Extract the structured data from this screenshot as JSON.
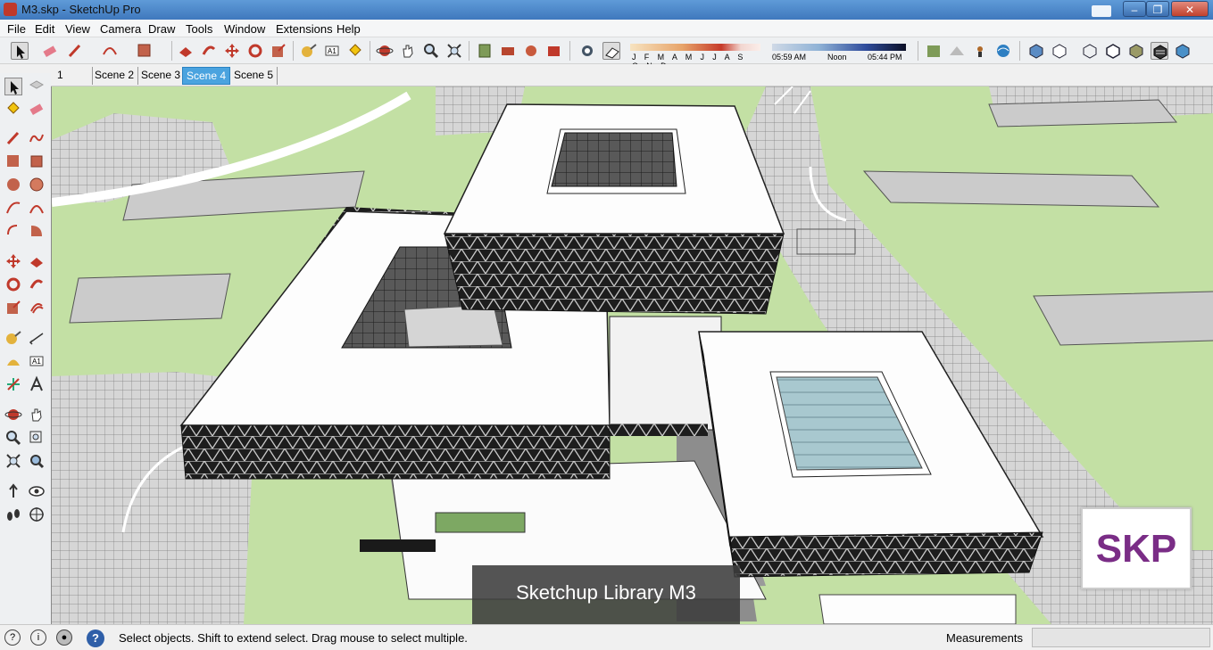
{
  "window": {
    "title": "M3.skp - SketchUp Pro"
  },
  "menu": [
    "File",
    "Edit",
    "View",
    "Camera",
    "Draw",
    "Tools",
    "Window",
    "Extensions",
    "Help"
  ],
  "shadows": {
    "months": "J F M A M J J A S O N D",
    "time_start": "05:59 AM",
    "time_mid": "Noon",
    "time_end": "05:44 PM"
  },
  "scenes": {
    "tabs": [
      "1",
      "Scene 2",
      "Scene 3",
      "Scene 4",
      "Scene 5"
    ],
    "active": "Scene 4"
  },
  "overlay": {
    "badge": "SKP",
    "caption": "Sketchup Library M3"
  },
  "status": {
    "message": "Select objects. Shift to extend select. Drag mouse to select multiple.",
    "measurements_label": "Measurements",
    "measurements_value": ""
  },
  "colors": {
    "accent": "#4aa3df",
    "ground": "#c3e0a4",
    "badge_text": "#7a2d86",
    "title_bar": "#4f8ccf"
  }
}
